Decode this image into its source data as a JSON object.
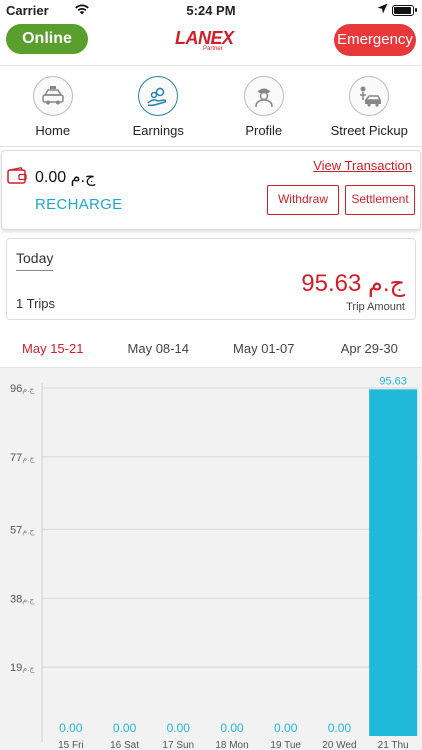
{
  "status_bar": {
    "carrier": "Carrier",
    "time": "5:24 PM"
  },
  "header": {
    "online_label": "Online",
    "logo_text": "LANEX",
    "logo_sub": "Partner",
    "emergency_label": "Emergency",
    "colors": {
      "online": "#5a9e2d",
      "emergency": "#e8383a",
      "brand": "#d0202c"
    }
  },
  "nav": {
    "items": [
      {
        "label": "Home",
        "icon": "taxi-icon"
      },
      {
        "label": "Earnings",
        "icon": "money-hand-icon"
      },
      {
        "label": "Profile",
        "icon": "driver-icon"
      },
      {
        "label": "Street Pickup",
        "icon": "street-pickup-icon"
      }
    ]
  },
  "wallet": {
    "balance": "ج.م 0.00",
    "recharge_label": "RECHARGE",
    "view_transaction_label": "View Transaction",
    "withdraw_label": "Withdraw",
    "settlement_label": "Settlement"
  },
  "today": {
    "label": "Today",
    "trips": "1 Trips",
    "amount": "ج.م 95.63",
    "amount_label": "Trip Amount"
  },
  "week_tabs": {
    "items": [
      "May 15-21",
      "May 08-14",
      "May 01-07",
      "Apr 29-30"
    ],
    "active_index": 0
  },
  "chart_data": {
    "type": "bar",
    "categories": [
      "15 Fri",
      "16 Sat",
      "17 Sun",
      "18 Mon",
      "19 Tue",
      "20 Wed",
      "21 Thu"
    ],
    "values": [
      0,
      0,
      0,
      0,
      0,
      0,
      95.63
    ],
    "value_labels": [
      "0.00",
      "0.00",
      "0.00",
      "0.00",
      "0.00",
      "0.00",
      "95.63"
    ],
    "y_ticks": [
      19,
      38,
      57,
      77,
      96
    ],
    "y_tick_prefix": "ج.م",
    "ylim": [
      0,
      96
    ],
    "grid": true,
    "bar_color": "#20b9da",
    "label_color": "#20b9da"
  }
}
